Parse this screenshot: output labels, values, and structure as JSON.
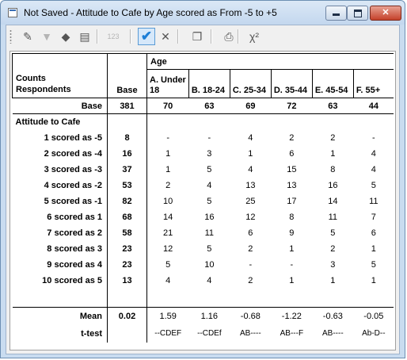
{
  "window": {
    "title": "Not Saved - Attitude to Cafe by Age scored as From -5 to +5",
    "buttons": {
      "minimize": "minimize",
      "maximize": "maximize",
      "close": "✕"
    }
  },
  "toolbar": {
    "items": [
      {
        "name": "edit-table-icon",
        "glyph": "✎",
        "enabled": true
      },
      {
        "name": "filter-icon",
        "glyph": "▼",
        "enabled": false
      },
      {
        "name": "fill-format-icon",
        "glyph": "◆",
        "enabled": true
      },
      {
        "name": "notes-icon",
        "glyph": "▤",
        "enabled": true
      },
      {
        "name": "numbering-icon",
        "label": "123",
        "enabled": false
      },
      {
        "name": "check-icon",
        "glyph": "✔",
        "enabled": true,
        "checked": true
      },
      {
        "name": "delete-icon",
        "glyph": "✕",
        "enabled": true
      },
      {
        "name": "copy-icon",
        "glyph": "❐",
        "enabled": true
      },
      {
        "name": "print-icon",
        "glyph": "⎙",
        "enabled": true
      },
      {
        "name": "chi-square-icon",
        "label": "χ²",
        "enabled": true
      }
    ]
  },
  "table": {
    "stub_header": {
      "line1": "Counts",
      "line2": "Respondents"
    },
    "base_header": "Base",
    "group_header": "Age",
    "columns": [
      {
        "line1": "A. Under",
        "line2": "18"
      },
      {
        "line1": "",
        "line2": "B. 18-24"
      },
      {
        "line1": "",
        "line2": "C. 25-34"
      },
      {
        "line1": "",
        "line2": "D. 35-44"
      },
      {
        "line1": "",
        "line2": "E. 45-54"
      },
      {
        "line1": "",
        "line2": "F. 55+"
      }
    ],
    "base_row": {
      "label": "Base",
      "base": "381",
      "values": [
        "70",
        "63",
        "69",
        "72",
        "63",
        "44"
      ]
    },
    "section_label": "Attitude to Cafe",
    "rows": [
      {
        "label": "1 scored as -5",
        "base": "8",
        "values": [
          "-",
          "-",
          "4",
          "2",
          "2",
          "-"
        ]
      },
      {
        "label": "2 scored as -4",
        "base": "16",
        "values": [
          "1",
          "3",
          "1",
          "6",
          "1",
          "4"
        ]
      },
      {
        "label": "3 scored as -3",
        "base": "37",
        "values": [
          "1",
          "5",
          "4",
          "15",
          "8",
          "4"
        ]
      },
      {
        "label": "4 scored as -2",
        "base": "53",
        "values": [
          "2",
          "4",
          "13",
          "13",
          "16",
          "5"
        ]
      },
      {
        "label": "5 scored as -1",
        "base": "82",
        "values": [
          "10",
          "5",
          "25",
          "17",
          "14",
          "11"
        ]
      },
      {
        "label": "6 scored as 1",
        "base": "68",
        "values": [
          "14",
          "16",
          "12",
          "8",
          "11",
          "7"
        ]
      },
      {
        "label": "7 scored as 2",
        "base": "58",
        "values": [
          "21",
          "11",
          "6",
          "9",
          "5",
          "6"
        ]
      },
      {
        "label": "8 scored as 3",
        "base": "23",
        "values": [
          "12",
          "5",
          "2",
          "1",
          "2",
          "1"
        ]
      },
      {
        "label": "9 scored as 4",
        "base": "23",
        "values": [
          "5",
          "10",
          "-",
          "-",
          "3",
          "5"
        ]
      },
      {
        "label": "10 scored as 5",
        "base": "13",
        "values": [
          "4",
          "4",
          "2",
          "1",
          "1",
          "1"
        ]
      }
    ],
    "mean_row": {
      "label": "Mean",
      "base": "0.02",
      "values": [
        "1.59",
        "1.16",
        "-0.68",
        "-1.22",
        "-0.63",
        "-0.05"
      ]
    },
    "ttest_row": {
      "label": "t-test",
      "base": "",
      "values": [
        "--CDEF",
        "--CDEf",
        "AB----",
        "AB---F",
        "AB----",
        "Ab-D--"
      ]
    }
  }
}
